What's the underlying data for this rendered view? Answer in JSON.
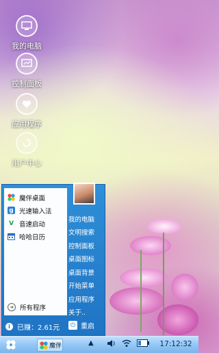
{
  "desktop": {
    "icons": [
      {
        "label": "我的电脑",
        "icon": "computer-icon"
      },
      {
        "label": "控制面板",
        "icon": "control-panel-icon"
      },
      {
        "label": "应用程序",
        "icon": "heart-icon"
      },
      {
        "label": "用户中心",
        "icon": "swirl-icon"
      }
    ]
  },
  "start_menu": {
    "pinned": [
      {
        "label": "魔伴桌面",
        "icon": "pinwheel-icon"
      },
      {
        "label": "光速输入法",
        "icon": "g-letter-icon"
      },
      {
        "label": "音速启动",
        "icon": "v-letter-icon"
      },
      {
        "label": "哈哈日历",
        "icon": "calendar-icon"
      }
    ],
    "all_programs": "所有程序",
    "right_items": [
      "我的电脑",
      "文明搜索",
      "控制面板",
      "桌面图标",
      "桌面背景",
      "开始菜单",
      "应用程序",
      "关于.."
    ],
    "earned_label": "已赚：2.61元",
    "restart_label": "重启"
  },
  "taskbar": {
    "task_item_label": "魔伴",
    "clock": "17:12:32"
  },
  "colors": {
    "menu_blue": "#1f74c4",
    "taskbar_blue": "#93c7f5"
  }
}
